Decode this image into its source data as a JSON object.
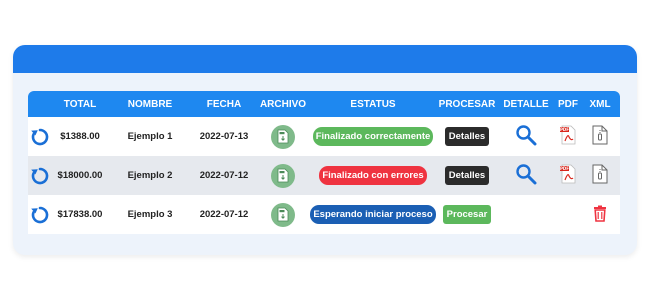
{
  "colors": {
    "header": "#1e7bea",
    "table_header": "#1e88f0",
    "accent_blue": "#1a6fd6"
  },
  "table": {
    "headers": {
      "total": "TOTAL",
      "nombre": "NOMBRE",
      "fecha": "FECHA",
      "archivo": "ARCHIVO",
      "estatus": "ESTATUS",
      "procesar": "PROCESAR",
      "detalle": "DETALLE",
      "pdf": "PDF",
      "xml": "XML"
    },
    "rows": [
      {
        "total": "$1388.00",
        "nombre": "Ejemplo 1",
        "fecha": "2022-07-13",
        "status": "Finalizado correctamente",
        "status_color": "#5cb85c",
        "action": "Detalles",
        "action_color": "#2b2b2b",
        "has_detail": true,
        "has_pdf": true,
        "has_xml": true,
        "has_delete": false
      },
      {
        "total": "$18000.00",
        "nombre": "Ejemplo 2",
        "fecha": "2022-07-12",
        "status": "Finalizado con errores",
        "status_color": "#ef3340",
        "action": "Detalles",
        "action_color": "#2b2b2b",
        "has_detail": true,
        "has_pdf": true,
        "has_xml": true,
        "has_delete": false
      },
      {
        "total": "$17838.00",
        "nombre": "Ejemplo 3",
        "fecha": "2022-07-12",
        "status": "Esperando iniciar proceso",
        "status_color": "#1b5fb4",
        "action": "Procesar",
        "action_color": "#5cb85c",
        "has_detail": false,
        "has_pdf": false,
        "has_xml": false,
        "has_delete": true
      }
    ]
  },
  "icons": {
    "refresh": "refresh-icon",
    "file": "file-icon",
    "search": "search-icon",
    "pdf": "pdf-icon",
    "xml": "xml-file-icon",
    "trash": "trash-icon"
  }
}
